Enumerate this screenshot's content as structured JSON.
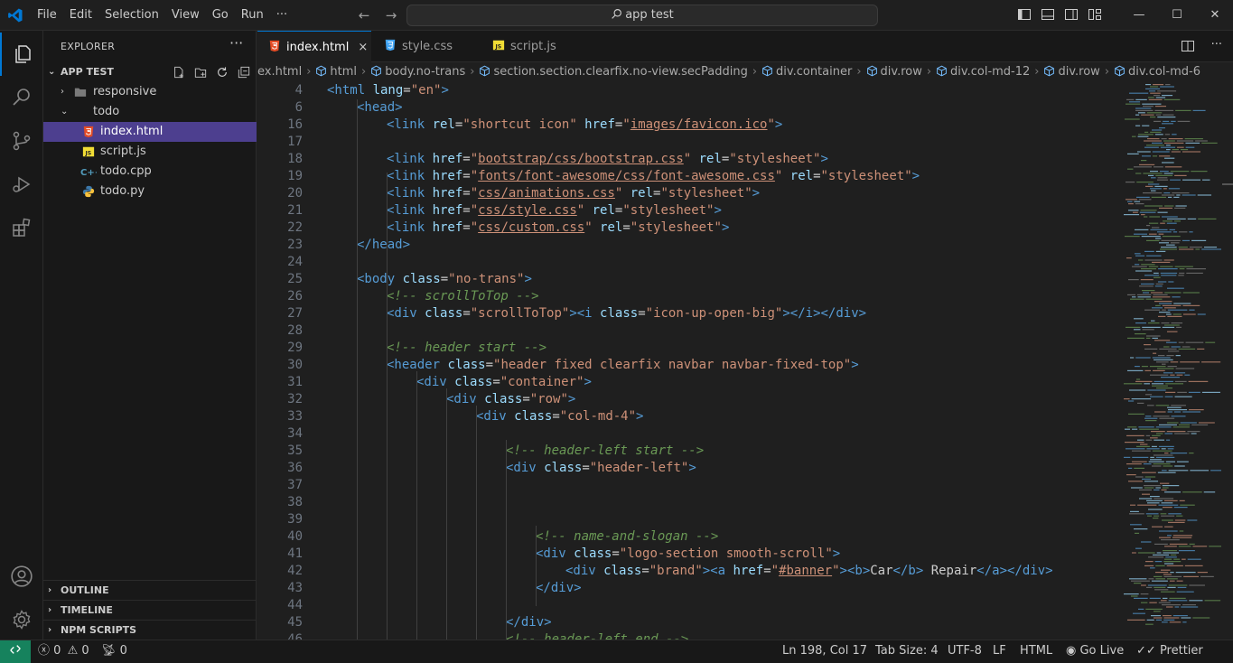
{
  "menu": [
    "File",
    "Edit",
    "Selection",
    "View",
    "Go",
    "Run",
    "···"
  ],
  "search": {
    "label": "app test"
  },
  "explorer": {
    "title": "EXPLORER",
    "dots": "···",
    "root": "APP TEST",
    "items": [
      {
        "label": "responsive",
        "type": "folder",
        "depth": 1,
        "open": false
      },
      {
        "label": "todo",
        "type": "folder",
        "depth": 1,
        "open": true
      },
      {
        "label": "index.html",
        "type": "html",
        "depth": 2,
        "selected": true
      },
      {
        "label": "script.js",
        "type": "js",
        "depth": 2
      },
      {
        "label": "todo.cpp",
        "type": "cpp",
        "depth": 1
      },
      {
        "label": "todo.py",
        "type": "py",
        "depth": 1
      }
    ],
    "panels": [
      "OUTLINE",
      "TIMELINE",
      "NPM SCRIPTS"
    ]
  },
  "tabs": [
    {
      "label": "index.html",
      "close": "×",
      "active": true
    },
    {
      "label": "style.css"
    },
    {
      "label": "script.js"
    }
  ],
  "breadcrumbs": [
    "ex.html",
    "html",
    "body.no-trans",
    "section.section.clearfix.no-view.secPadding",
    "div.container",
    "div.row",
    "div.col-md-12",
    "div.row",
    "div.col-md-6"
  ],
  "code": [
    {
      "n": "4",
      "parts": [
        [
          "tag",
          "<html "
        ],
        [
          "attr",
          "lang"
        ],
        [
          "txt",
          "="
        ],
        [
          "str",
          "\"en\""
        ],
        [
          "tag",
          ">"
        ]
      ]
    },
    {
      "n": "6",
      "indent": 1,
      "parts": [
        [
          "tag",
          "<head"
        ],
        [
          "tag",
          ">"
        ]
      ]
    },
    {
      "n": "16",
      "indent": 2,
      "parts": [
        [
          "tag",
          "<link "
        ],
        [
          "attr",
          "rel"
        ],
        [
          "txt",
          "="
        ],
        [
          "str",
          "\"shortcut icon\" "
        ],
        [
          "attr",
          "href"
        ],
        [
          "txt",
          "="
        ],
        [
          "str",
          "\""
        ],
        [
          "stru",
          "images/favicon.ico"
        ],
        [
          "str",
          "\""
        ],
        [
          "tag",
          ">"
        ]
      ]
    },
    {
      "n": "17",
      "parts": []
    },
    {
      "n": "18",
      "indent": 2,
      "parts": [
        [
          "tag",
          "<link "
        ],
        [
          "attr",
          "href"
        ],
        [
          "txt",
          "="
        ],
        [
          "str",
          "\""
        ],
        [
          "stru",
          "bootstrap/css/bootstrap.css"
        ],
        [
          "str",
          "\" "
        ],
        [
          "attr",
          "rel"
        ],
        [
          "txt",
          "="
        ],
        [
          "str",
          "\"stylesheet\""
        ],
        [
          "tag",
          ">"
        ]
      ]
    },
    {
      "n": "19",
      "indent": 2,
      "parts": [
        [
          "tag",
          "<link "
        ],
        [
          "attr",
          "href"
        ],
        [
          "txt",
          "="
        ],
        [
          "str",
          "\""
        ],
        [
          "stru",
          "fonts/font-awesome/css/font-awesome.css"
        ],
        [
          "str",
          "\" "
        ],
        [
          "attr",
          "rel"
        ],
        [
          "txt",
          "="
        ],
        [
          "str",
          "\"stylesheet\""
        ],
        [
          "tag",
          ">"
        ]
      ]
    },
    {
      "n": "20",
      "indent": 2,
      "parts": [
        [
          "tag",
          "<link "
        ],
        [
          "attr",
          "href"
        ],
        [
          "txt",
          "="
        ],
        [
          "str",
          "\""
        ],
        [
          "stru",
          "css/animations.css"
        ],
        [
          "str",
          "\" "
        ],
        [
          "attr",
          "rel"
        ],
        [
          "txt",
          "="
        ],
        [
          "str",
          "\"stylesheet\""
        ],
        [
          "tag",
          ">"
        ]
      ]
    },
    {
      "n": "21",
      "indent": 2,
      "parts": [
        [
          "tag",
          "<link "
        ],
        [
          "attr",
          "href"
        ],
        [
          "txt",
          "="
        ],
        [
          "str",
          "\""
        ],
        [
          "stru",
          "css/style.css"
        ],
        [
          "str",
          "\" "
        ],
        [
          "attr",
          "rel"
        ],
        [
          "txt",
          "="
        ],
        [
          "str",
          "\"stylesheet\""
        ],
        [
          "tag",
          ">"
        ]
      ]
    },
    {
      "n": "22",
      "indent": 2,
      "parts": [
        [
          "tag",
          "<link "
        ],
        [
          "attr",
          "href"
        ],
        [
          "txt",
          "="
        ],
        [
          "str",
          "\""
        ],
        [
          "stru",
          "css/custom.css"
        ],
        [
          "str",
          "\" "
        ],
        [
          "attr",
          "rel"
        ],
        [
          "txt",
          "="
        ],
        [
          "str",
          "\"stylesheet\""
        ],
        [
          "tag",
          ">"
        ]
      ]
    },
    {
      "n": "23",
      "indent": 1,
      "parts": [
        [
          "tag",
          "</head>"
        ]
      ]
    },
    {
      "n": "24",
      "parts": []
    },
    {
      "n": "25",
      "indent": 1,
      "parts": [
        [
          "tag",
          "<body "
        ],
        [
          "attr",
          "class"
        ],
        [
          "txt",
          "="
        ],
        [
          "str",
          "\"no-trans\""
        ],
        [
          "tag",
          ">"
        ]
      ]
    },
    {
      "n": "26",
      "indent": 2,
      "parts": [
        [
          "com",
          "<!-- scrollToTop -->"
        ]
      ]
    },
    {
      "n": "27",
      "indent": 2,
      "parts": [
        [
          "tag",
          "<div "
        ],
        [
          "attr",
          "class"
        ],
        [
          "txt",
          "="
        ],
        [
          "str",
          "\"scrollToTop\""
        ],
        [
          "tag",
          "><i "
        ],
        [
          "attr",
          "class"
        ],
        [
          "txt",
          "="
        ],
        [
          "str",
          "\"icon-up-open-big\""
        ],
        [
          "tag",
          "></i></div>"
        ]
      ]
    },
    {
      "n": "28",
      "parts": []
    },
    {
      "n": "29",
      "indent": 2,
      "parts": [
        [
          "com",
          "<!-- header start -->"
        ]
      ]
    },
    {
      "n": "30",
      "indent": 2,
      "parts": [
        [
          "tag",
          "<header "
        ],
        [
          "attr",
          "class"
        ],
        [
          "txt",
          "="
        ],
        [
          "str",
          "\"header fixed clearfix navbar navbar-fixed-top\""
        ],
        [
          "tag",
          ">"
        ]
      ]
    },
    {
      "n": "31",
      "indent": 3,
      "parts": [
        [
          "tag",
          "<div "
        ],
        [
          "attr",
          "class"
        ],
        [
          "txt",
          "="
        ],
        [
          "str",
          "\"container\""
        ],
        [
          "tag",
          ">"
        ]
      ]
    },
    {
      "n": "32",
      "indent": 4,
      "parts": [
        [
          "tag",
          "<div "
        ],
        [
          "attr",
          "class"
        ],
        [
          "txt",
          "="
        ],
        [
          "str",
          "\"row\""
        ],
        [
          "tag",
          ">"
        ]
      ]
    },
    {
      "n": "33",
      "indent": 5,
      "parts": [
        [
          "tag",
          "<div "
        ],
        [
          "attr",
          "class"
        ],
        [
          "txt",
          "="
        ],
        [
          "str",
          "\"col-md-4\""
        ],
        [
          "tag",
          ">"
        ]
      ]
    },
    {
      "n": "34",
      "parts": []
    },
    {
      "n": "35",
      "indent": 6,
      "parts": [
        [
          "com",
          "<!-- header-left start -->"
        ]
      ]
    },
    {
      "n": "36",
      "indent": 6,
      "parts": [
        [
          "tag",
          "<div "
        ],
        [
          "attr",
          "class"
        ],
        [
          "txt",
          "="
        ],
        [
          "str",
          "\"header-left\""
        ],
        [
          "tag",
          ">"
        ]
      ]
    },
    {
      "n": "37",
      "parts": []
    },
    {
      "n": "38",
      "parts": []
    },
    {
      "n": "39",
      "parts": []
    },
    {
      "n": "40",
      "indent": 7,
      "parts": [
        [
          "com",
          "<!-- name-and-slogan -->"
        ]
      ]
    },
    {
      "n": "41",
      "indent": 7,
      "parts": [
        [
          "tag",
          "<div "
        ],
        [
          "attr",
          "class"
        ],
        [
          "txt",
          "="
        ],
        [
          "str",
          "\"logo-section smooth-scroll\""
        ],
        [
          "tag",
          ">"
        ]
      ]
    },
    {
      "n": "42",
      "indent": 8,
      "parts": [
        [
          "tag",
          "<div "
        ],
        [
          "attr",
          "class"
        ],
        [
          "txt",
          "="
        ],
        [
          "str",
          "\"brand\""
        ],
        [
          "tag",
          "><a "
        ],
        [
          "attr",
          "href"
        ],
        [
          "txt",
          "="
        ],
        [
          "str",
          "\""
        ],
        [
          "stru",
          "#banner"
        ],
        [
          "str",
          "\""
        ],
        [
          "tag",
          "><b>"
        ],
        [
          "txt",
          "Car"
        ],
        [
          "tag",
          "</b>"
        ],
        [
          "txt",
          " Repair"
        ],
        [
          "tag",
          "</a></div>"
        ]
      ]
    },
    {
      "n": "43",
      "indent": 7,
      "parts": [
        [
          "tag",
          "</div>"
        ]
      ]
    },
    {
      "n": "44",
      "parts": []
    },
    {
      "n": "45",
      "indent": 6,
      "parts": [
        [
          "tag",
          "</div>"
        ]
      ]
    },
    {
      "n": "46",
      "indent": 6,
      "parts": [
        [
          "com",
          "<!-- header-left end -->"
        ]
      ]
    }
  ],
  "status": {
    "errors": "0",
    "warnings": "0",
    "ports": "0",
    "position": "Ln 198, Col 17",
    "tabsize": "Tab Size: 4",
    "encoding": "UTF-8",
    "eol": "LF",
    "language": "HTML",
    "golive": "Go Live",
    "prettier": "Prettier"
  },
  "colors": {
    "accent": "#0078d4",
    "selection": "#4d3f8f",
    "remote": "#16825d"
  },
  "icons": [
    "vscode-logo-icon",
    "search-icon",
    "files-icon",
    "source-control-icon",
    "run-debug-icon",
    "extensions-icon",
    "account-icon",
    "gear-icon",
    "split-editor-icon"
  ]
}
